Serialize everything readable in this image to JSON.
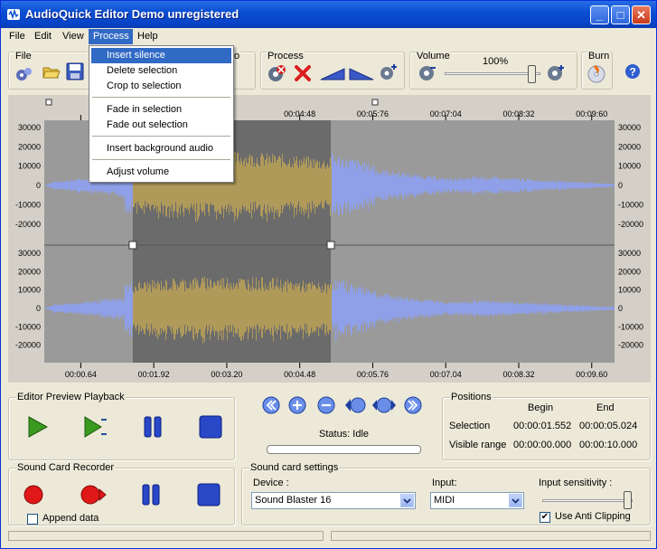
{
  "app": {
    "title": "AudioQuick Editor Demo unregistered",
    "accent": "#0a4fd4"
  },
  "menubar": {
    "items": [
      {
        "label": "File"
      },
      {
        "label": "Edit"
      },
      {
        "label": "View"
      },
      {
        "label": "Process"
      },
      {
        "label": "Help"
      }
    ]
  },
  "process_menu": {
    "items": [
      {
        "label": "Insert silence"
      },
      {
        "label": "Delete selection"
      },
      {
        "label": "Crop to selection"
      },
      {
        "label": "Fade in selection"
      },
      {
        "label": "Fade out selection"
      },
      {
        "label": "Insert background audio"
      },
      {
        "label": "Adjust volume"
      }
    ]
  },
  "toolbar": {
    "file_label": "File",
    "partial_label": "o",
    "process_label": "Process",
    "volume_label": "Volume",
    "volume_value": "100%",
    "volume_level": 1.0,
    "burn_label": "Burn",
    "icons": [
      "open-icon",
      "save-icon",
      "process-icon",
      "delete-icon",
      "fade-in-icon",
      "fade-out-icon",
      "volume-down-icon",
      "volume-up-icon",
      "burn-icon",
      "help-icon"
    ]
  },
  "waveform": {
    "time_ticks_top": [
      "",
      "",
      ":20",
      "00:04:48",
      "00:05:76",
      "00:07:04",
      "00:08:32",
      "00:09:60"
    ],
    "time_ticks_bottom": [
      "00:00.64",
      "00:01.92",
      "00:03.20",
      "00:04.48",
      "00:05.76",
      "00:07.04",
      "00:08.32",
      "00:09.60"
    ],
    "amplitude_ticks": [
      "30000",
      "20000",
      "10000",
      "0",
      "-10000",
      "-20000"
    ],
    "selection_start": 0.1552,
    "selection_end": 0.5024,
    "colors": {
      "background": "#9a9a9a",
      "selection_bg": "#6b6b6b",
      "wave": "#8fa0e8",
      "wave_selected": "#b09a5a"
    }
  },
  "playback": {
    "title": "Editor Preview Playback",
    "buttons": [
      "play-icon",
      "play-selection-icon",
      "pause-icon",
      "stop-icon"
    ]
  },
  "recorder": {
    "title": "Sound Card Recorder",
    "append_label": "Append data",
    "append_checked": false
  },
  "zoom": {
    "buttons": [
      "zoom-start-icon",
      "zoom-in-icon",
      "zoom-out-icon",
      "zoom-selection-icon",
      "zoom-all-icon",
      "zoom-end-icon"
    ],
    "status_text": "Status: Idle"
  },
  "positions": {
    "title": "Positions",
    "col_begin": "Begin",
    "col_end": "End",
    "rows": [
      {
        "label": "Selection",
        "begin": "00:00:01.552",
        "end": "00:00:05.024"
      },
      {
        "label": "Visible range",
        "begin": "00:00:00.000",
        "end": "00:00:10.000"
      }
    ]
  },
  "soundcard": {
    "title": "Sound card settings",
    "device_label": "Device :",
    "device_value": "Sound Blaster 16",
    "input_label": "Input:",
    "input_value": "MIDI",
    "sensitivity_label": "Input sensitivity :",
    "sensitivity_level": 1.0,
    "anticlipping_label": "Use Anti Clipping",
    "anticlipping_checked": true
  }
}
